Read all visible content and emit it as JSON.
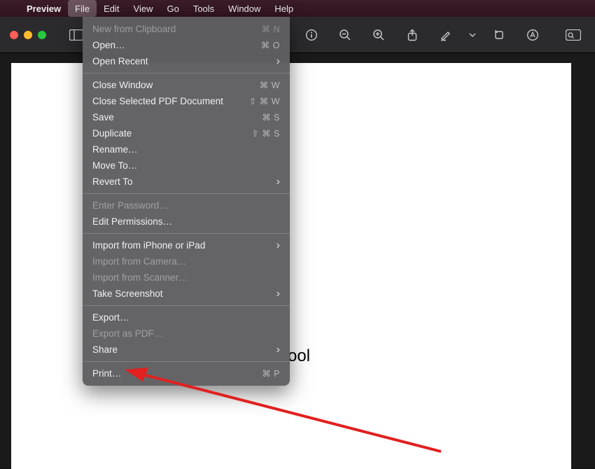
{
  "menubar": {
    "app_name": "Preview",
    "items": [
      "File",
      "Edit",
      "View",
      "Go",
      "Tools",
      "Window",
      "Help"
    ],
    "active_index": 0
  },
  "file_menu": {
    "groups": [
      [
        {
          "label": "New from Clipboard",
          "shortcut": "⌘ N",
          "disabled": true
        },
        {
          "label": "Open…",
          "shortcut": "⌘ O"
        },
        {
          "label": "Open Recent",
          "submenu": true
        }
      ],
      [
        {
          "label": "Close Window",
          "shortcut": "⌘ W"
        },
        {
          "label": "Close Selected PDF Document",
          "shortcut": "⇧ ⌘ W"
        },
        {
          "label": "Save",
          "shortcut": "⌘ S"
        },
        {
          "label": "Duplicate",
          "shortcut": "⇧ ⌘ S"
        },
        {
          "label": "Rename…"
        },
        {
          "label": "Move To…"
        },
        {
          "label": "Revert To",
          "submenu": true
        }
      ],
      [
        {
          "label": "Enter Password…",
          "disabled": true
        },
        {
          "label": "Edit Permissions…"
        }
      ],
      [
        {
          "label": "Import from iPhone or iPad",
          "submenu": true
        },
        {
          "label": "Import from Camera…",
          "disabled": true
        },
        {
          "label": "Import from Scanner…",
          "disabled": true
        },
        {
          "label": "Take Screenshot",
          "submenu": true
        }
      ],
      [
        {
          "label": "Export…"
        },
        {
          "label": "Export as PDF…",
          "disabled": true
        },
        {
          "label": "Share",
          "submenu": true
        }
      ],
      [
        {
          "label": "Print…",
          "shortcut": "⌘ P"
        }
      ]
    ]
  },
  "document": {
    "visible_text_fragment": "ool"
  }
}
